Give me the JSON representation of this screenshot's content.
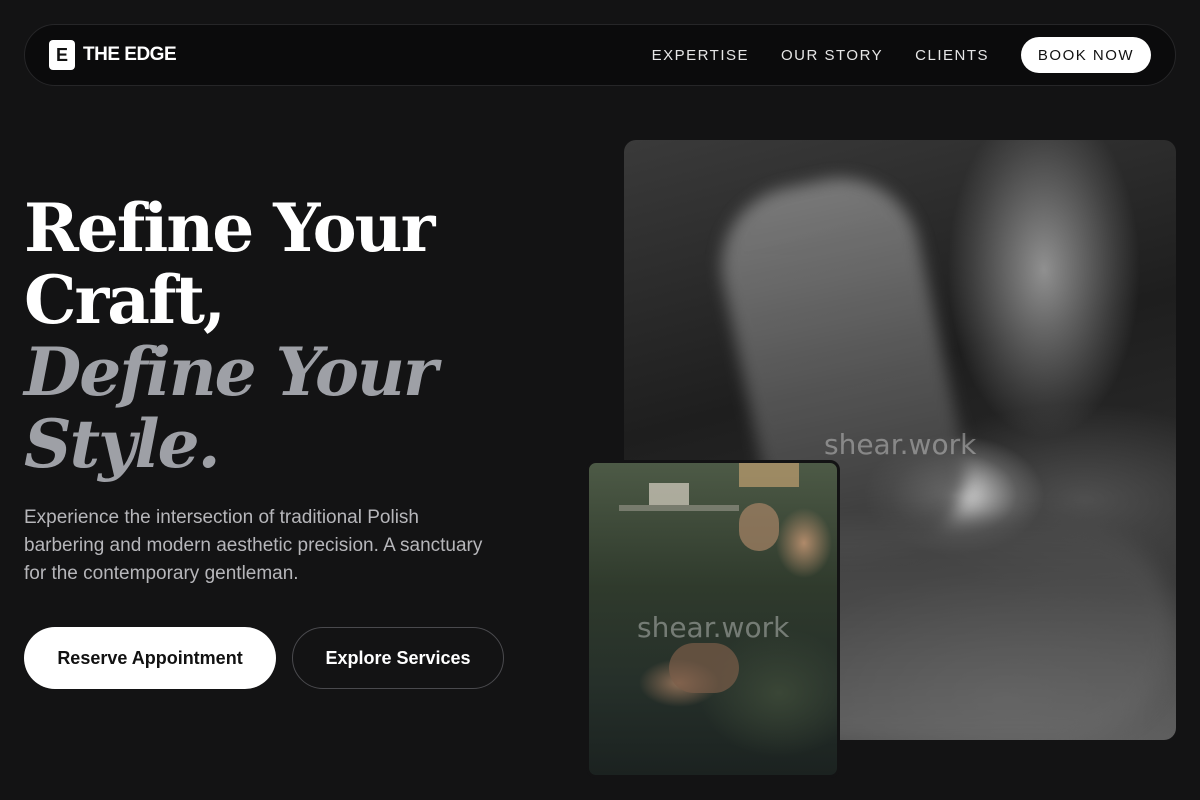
{
  "brand": {
    "mark": "E",
    "name": "THE EDGE"
  },
  "nav": {
    "links": [
      "EXPERTISE",
      "OUR STORY",
      "CLIENTS"
    ],
    "cta": "BOOK NOW"
  },
  "hero": {
    "headline_line1": "Refine Your",
    "headline_line2": "Craft,",
    "headline_line3": "Define Your",
    "headline_line4": "Style.",
    "lead": "Experience the intersection of traditional Polish barbering and modern aesthetic precision. A sanctuary for the contemporary gentleman.",
    "primary_button": "Reserve Appointment",
    "secondary_button": "Explore Services"
  },
  "images": {
    "large_watermark": "shear.work",
    "small_watermark": "shear.work"
  },
  "colors": {
    "background": "#131314",
    "accent_italic": "#9ea0a6",
    "button_light": "#ffffff"
  }
}
